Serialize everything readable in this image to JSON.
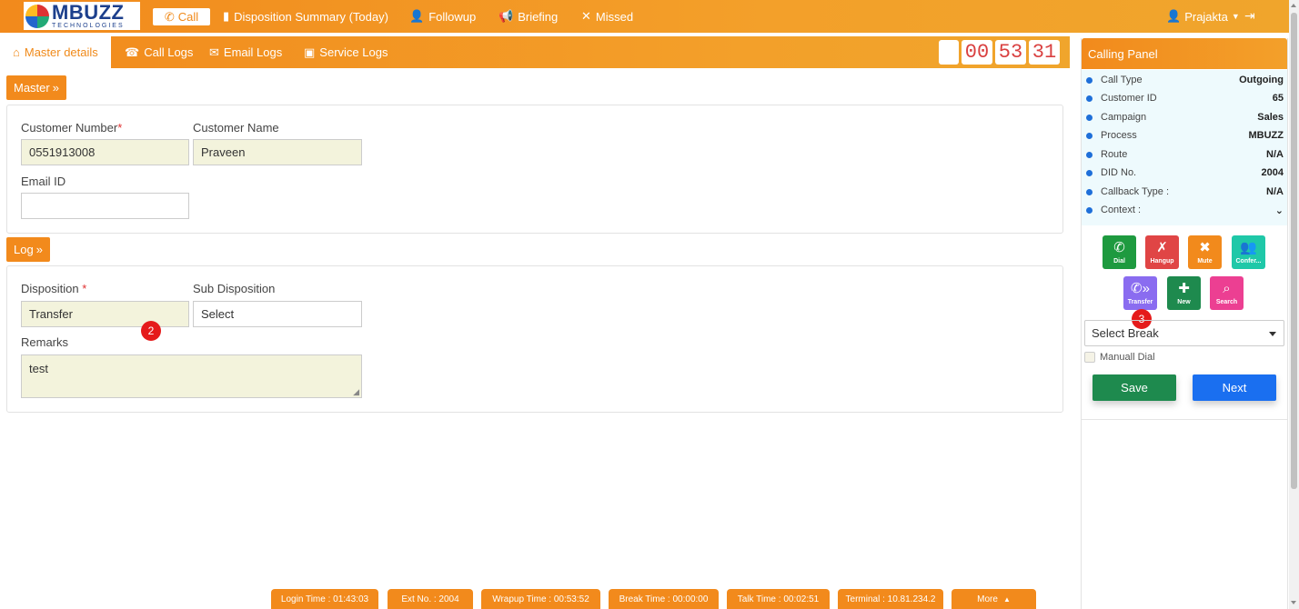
{
  "header": {
    "logo_name": "MBUZZ",
    "logo_sub": "TECHNOLOGIES",
    "call_label": "Call",
    "nav": [
      {
        "label": "Disposition Summary (Today)",
        "icon": "clipboard-icon"
      },
      {
        "label": "Followup",
        "icon": "user-plus-icon"
      },
      {
        "label": "Briefing",
        "icon": "megaphone-icon"
      },
      {
        "label": "Missed",
        "icon": "missed-call-icon"
      }
    ],
    "user": "Prajakta",
    "accent_color": "#f28a1c"
  },
  "tabs": [
    {
      "label": "Master details",
      "icon": "home-icon",
      "active": true
    },
    {
      "label": "Call Logs",
      "icon": "phone-square-icon"
    },
    {
      "label": "Email Logs",
      "icon": "envelope-icon"
    },
    {
      "label": "Service Logs",
      "icon": "service-icon"
    }
  ],
  "timer": {
    "h": "",
    "m": "00",
    "s1": "53",
    "s2": "31"
  },
  "master": {
    "section_label": "Master",
    "customer_number_label": "Customer Number",
    "customer_number": "0551913008",
    "customer_name_label": "Customer Name",
    "customer_name": "Praveen",
    "email_label": "Email ID",
    "email": ""
  },
  "log": {
    "section_label": "Log",
    "disposition_label": "Disposition",
    "disposition": "Transfer",
    "sub_disposition_label": "Sub Disposition",
    "sub_disposition": "Select",
    "remarks_label": "Remarks",
    "remarks": "test",
    "badge": "2"
  },
  "calling_panel": {
    "title": "Calling Panel",
    "rows": [
      {
        "label": "Call Type",
        "value": "Outgoing"
      },
      {
        "label": "Customer ID",
        "value": "65"
      },
      {
        "label": "Campaign",
        "value": "Sales"
      },
      {
        "label": "Process",
        "value": "MBUZZ"
      },
      {
        "label": "Route",
        "value": "N/A"
      },
      {
        "label": "DID No.",
        "value": "2004"
      },
      {
        "label": "Callback Type :",
        "value": "N/A"
      },
      {
        "label": "Context :",
        "value": ""
      }
    ],
    "actions": [
      {
        "label": "Dial",
        "color": "#1e9a3f",
        "icon": "phone-icon"
      },
      {
        "label": "Hangup",
        "color": "#e04545",
        "icon": "hangup-icon"
      },
      {
        "label": "Mute",
        "color": "#f28a1c",
        "icon": "mute-icon"
      },
      {
        "label": "Confer...",
        "color": "#1fc8a8",
        "icon": "conference-icon"
      },
      {
        "label": "Transfer",
        "color": "#8a6cf0",
        "icon": "transfer-icon"
      },
      {
        "label": "New",
        "color": "#1e8a4e",
        "icon": "plus-icon"
      },
      {
        "label": "Search",
        "color": "#ec3f92",
        "icon": "search-icon"
      }
    ],
    "badge": "3",
    "select_break": "Select Break",
    "manual_dial_label": "Manuall Dial",
    "save_label": "Save",
    "next_label": "Next"
  },
  "status_bar": [
    "Login Time : 01:43:03",
    "Ext No. : 2004",
    "Wrapup Time : 00:53:52",
    "Break Time : 00:00:00",
    "Talk Time : 00:02:51",
    "Terminal : 10.81.234.2",
    "More"
  ]
}
